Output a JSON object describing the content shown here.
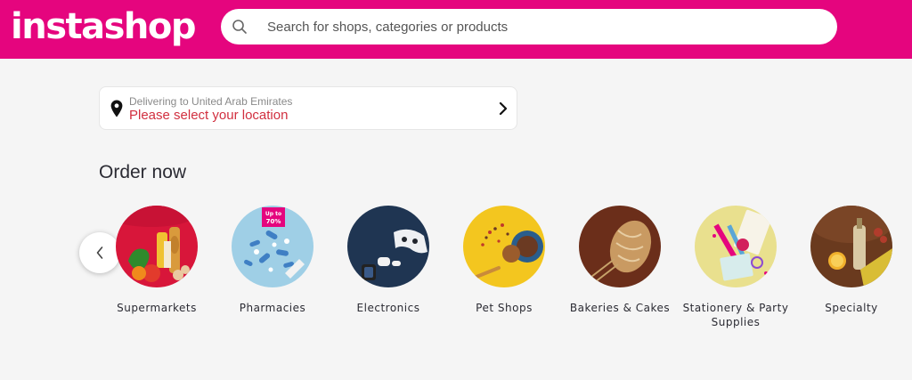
{
  "header": {
    "logo": "instashop",
    "brand_color": "#e5057e",
    "search": {
      "placeholder": "Search for shops, categories or products",
      "value": "",
      "icon": "search-icon"
    }
  },
  "location": {
    "subtitle": "Delivering to United Arab Emirates",
    "prompt": "Please select your location",
    "icon": "map-pin-icon",
    "chevron": "chevron-right-icon"
  },
  "order_now": {
    "title": "Order now",
    "prev_icon": "chevron-left-icon",
    "categories": [
      {
        "label": "Supermarkets"
      },
      {
        "label": "Pharmacies",
        "badge_line1": "Up to",
        "badge_line2": "70%"
      },
      {
        "label": "Electronics"
      },
      {
        "label": "Pet Shops"
      },
      {
        "label": "Bakeries & Cakes"
      },
      {
        "label": "Stationery & Party Supplies"
      },
      {
        "label": "Specialty"
      }
    ]
  }
}
